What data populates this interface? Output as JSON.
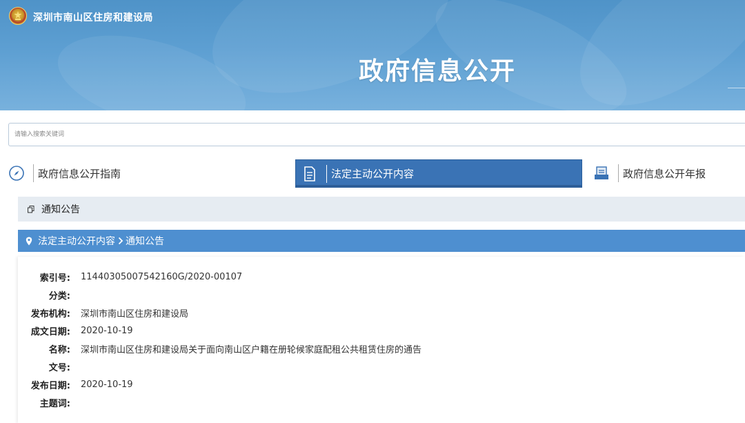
{
  "header": {
    "site_name": "深圳市南山区住房和建设局",
    "banner_title": "政府信息公开"
  },
  "search": {
    "placeholder": "请输入搜索关键词"
  },
  "tabs": [
    {
      "label": "政府信息公开指南",
      "icon": "compass-icon",
      "active": false
    },
    {
      "label": "法定主动公开内容",
      "icon": "document-icon",
      "active": true
    },
    {
      "label": "政府信息公开年报",
      "icon": "report-icon",
      "active": false
    }
  ],
  "section": {
    "title": "通知公告",
    "icon": "copy-icon"
  },
  "breadcrumb": {
    "items": [
      "法定主动公开内容",
      "通知公告"
    ],
    "icon": "location-pin-icon"
  },
  "details": {
    "fields": [
      {
        "key": "索引号:",
        "value": "11440305007542160G/2020-00107"
      },
      {
        "key": "分类:",
        "value": ""
      },
      {
        "key": "发布机构:",
        "value": "深圳市南山区住房和建设局"
      },
      {
        "key": "成文日期:",
        "value": "2020-10-19"
      },
      {
        "key": "名称:",
        "value": "深圳市南山区住房和建设局关于面向南山区户籍在册轮候家庭配租公共租赁住房的通告"
      },
      {
        "key": "文号:",
        "value": ""
      },
      {
        "key": "发布日期:",
        "value": "2020-10-19"
      },
      {
        "key": "主题词:",
        "value": ""
      }
    ]
  },
  "colors": {
    "banner": "#5d9fd2",
    "active_tab": "#3a73b5",
    "breadcrumb_bar": "#4e8fd0",
    "section_bar": "#e6ecf2"
  }
}
